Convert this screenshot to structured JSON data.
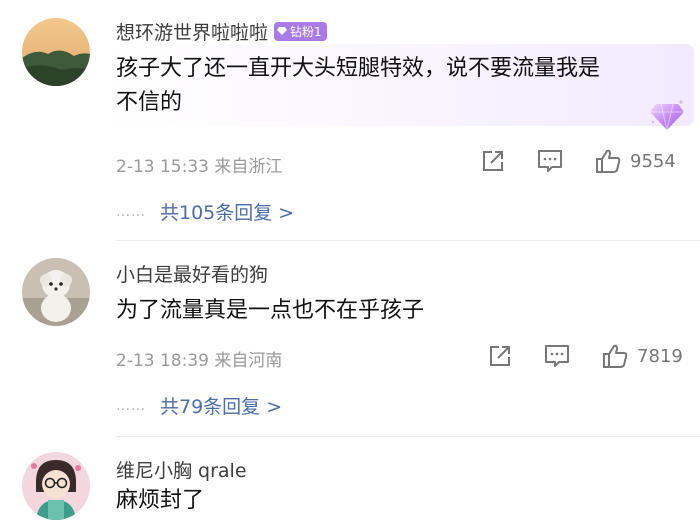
{
  "comments": [
    {
      "username": "想环游世界啦啦啦",
      "badge": "钻粉1",
      "text_line1": "孩子大了还一直开大头短腿特效，说不要流量我是",
      "text_line2": "不信的",
      "meta": "2-13 15:33 来自浙江",
      "likes": "9554",
      "replies": "共105条回复 >"
    },
    {
      "username": "小白是最好看的狗",
      "text_line1": "为了流量真是一点也不在乎孩子",
      "meta": "2-13 18:39 来自河南",
      "likes": "7819",
      "replies": "共79条回复 >"
    },
    {
      "username": "维尼小胸 qrale",
      "text_line1": "麻烦封了"
    }
  ],
  "replies_dots": "……",
  "colors": {
    "link": "#4a6ea8",
    "badge": "#a97be8"
  },
  "icons": [
    "share-icon",
    "comment-icon",
    "like-icon",
    "diamond-icon",
    "gem-icon"
  ]
}
